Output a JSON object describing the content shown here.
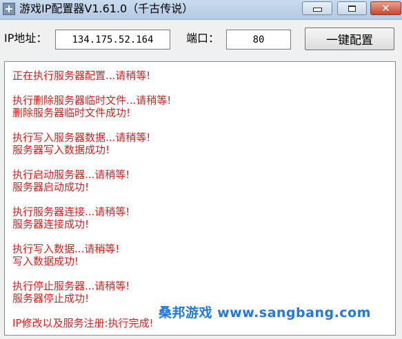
{
  "window": {
    "title": "游戏IP配置器V1.61.0（千古传说）"
  },
  "config": {
    "ip_label": "IP地址：",
    "ip_value": "134.175.52.164",
    "port_label": "端口：",
    "port_value": "80",
    "button_label": "一键配置"
  },
  "log": [
    "正在执行服务器配置...请稍等!",
    "执行删除服务器临时文件...请稍等!",
    "删除服务器临时文件成功!",
    "执行写入服务器数据...请稍等!",
    "服务器写入数据成功!",
    "执行启动服务器...请稍等!",
    "服务器启动成功!",
    "执行服务器连接...请稍等!",
    "服务器连接成功!",
    "执行写入数据...请稍等!",
    "写入数据成功!",
    "执行停止服务器...请稍等!",
    "服务器停止成功!",
    "IP修改以及服务注册:执行完成!"
  ],
  "watermark": "桑邦游戏 www.sangbang.com",
  "colors": {
    "log_text": "#e02020",
    "watermark": "#1f78e6",
    "titlebar": "#b9cfe6"
  }
}
